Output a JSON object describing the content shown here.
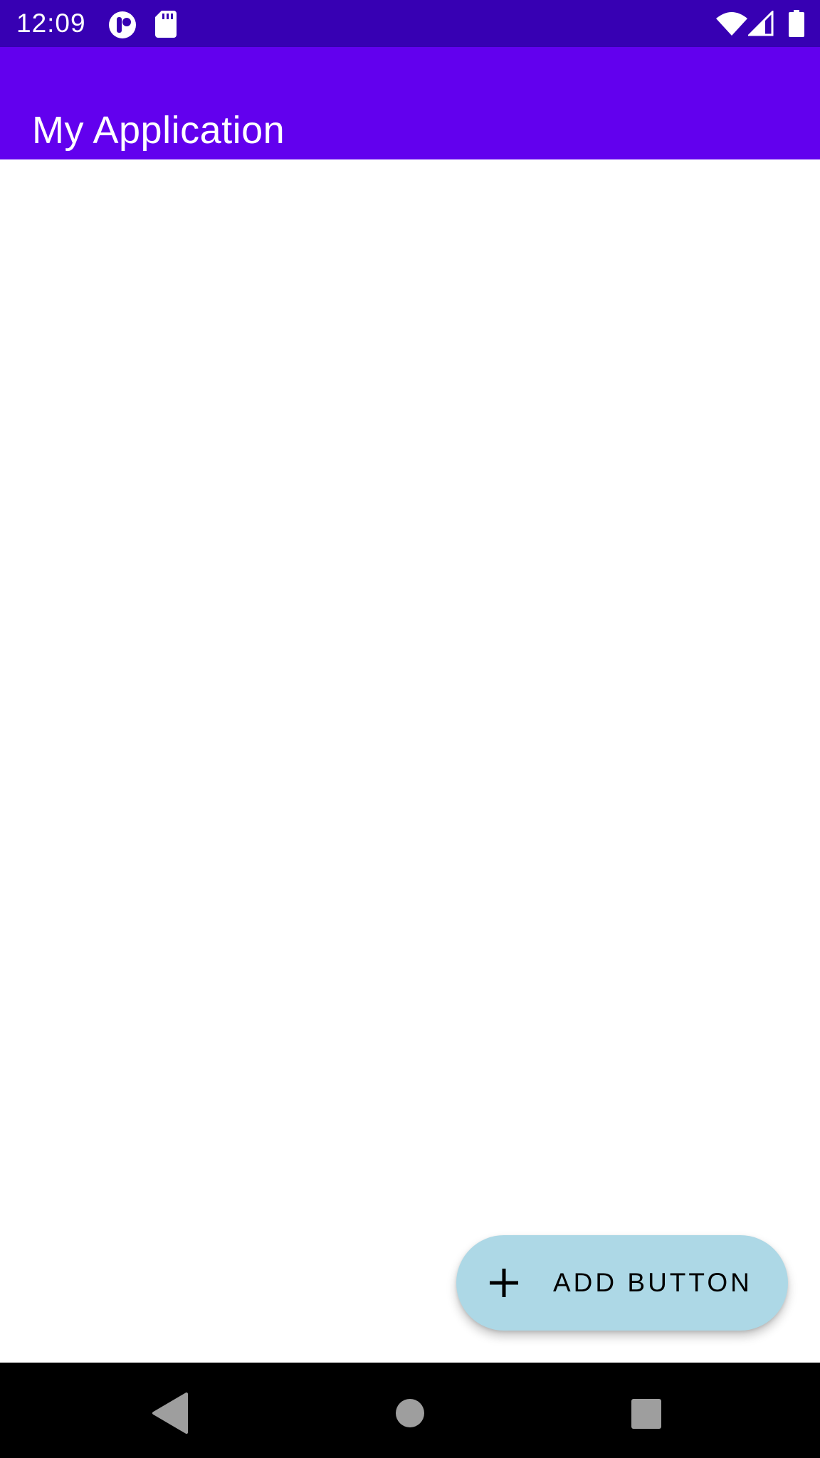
{
  "status_bar": {
    "time": "12:09",
    "icons": [
      "notification-app-icon",
      "sd-card-icon",
      "wifi-icon",
      "signal-icon",
      "battery-icon"
    ]
  },
  "app_bar": {
    "title": "My Application"
  },
  "fab": {
    "icon": "plus-icon",
    "label": "ADD BUTTON"
  },
  "nav_bar": {
    "buttons": [
      "back-icon",
      "home-icon",
      "recents-icon"
    ]
  },
  "colors": {
    "status_bar": "#3700b3",
    "app_bar": "#6200ee",
    "fab_background": "#add8e6",
    "nav_bar": "#000000",
    "nav_icons": "#9e9e9e"
  }
}
